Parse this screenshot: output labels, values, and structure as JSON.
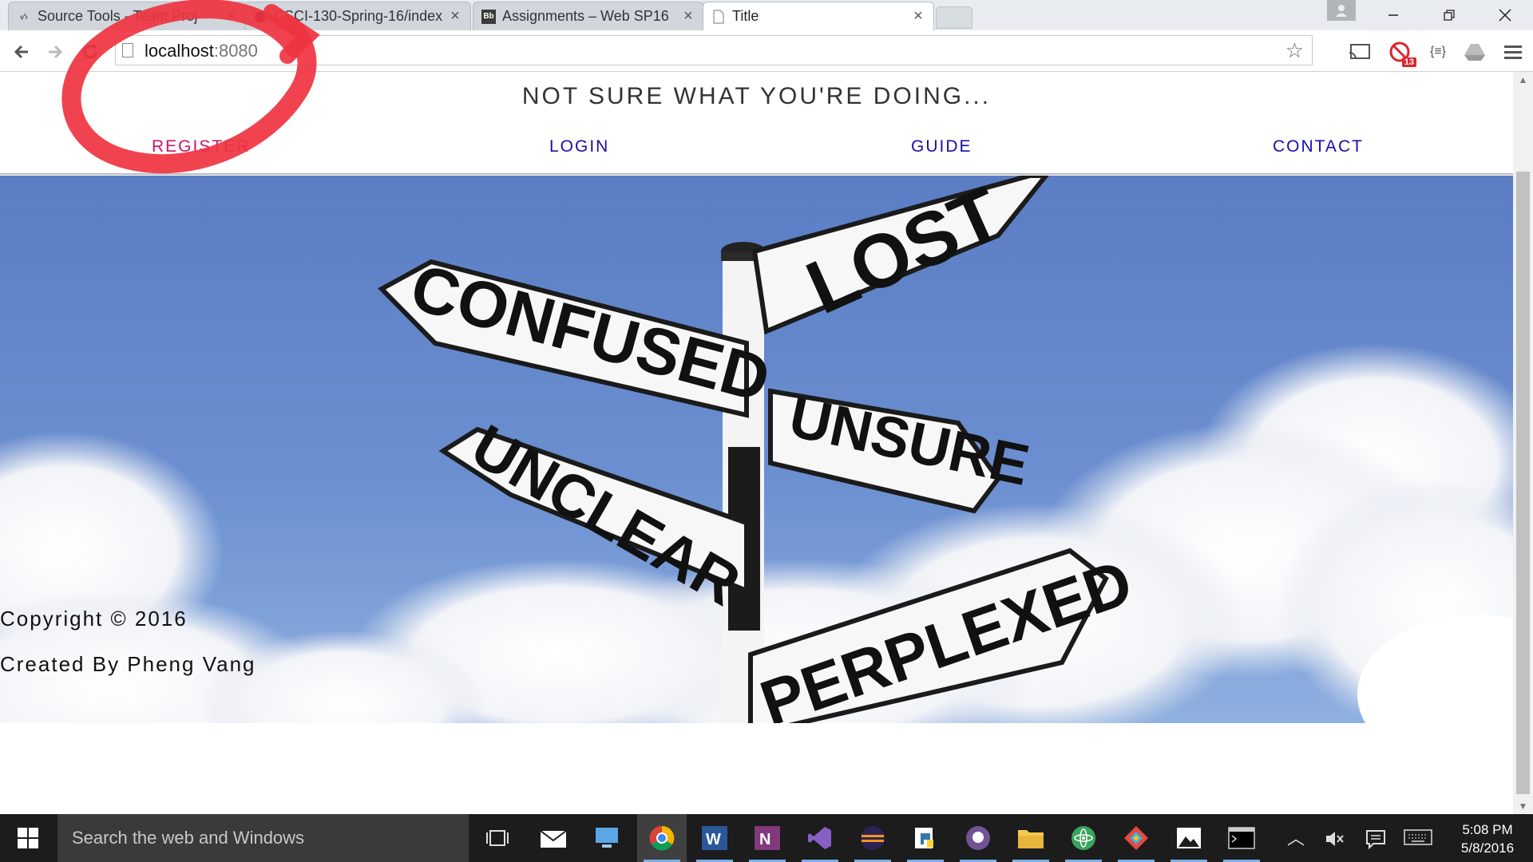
{
  "browser": {
    "tabs": [
      {
        "label": "Source Tools - Team Proj",
        "icon": "code-brackets-icon"
      },
      {
        "label": "CSCI-130-Spring-16/index",
        "icon": "github-icon"
      },
      {
        "label": "Assignments – Web SP16",
        "icon": "blackboard-icon"
      },
      {
        "label": "Title",
        "icon": "page-icon"
      }
    ],
    "url_host": "localhost",
    "url_port": ":8080",
    "extension_badge": "13"
  },
  "site": {
    "title": "NOT SURE WHAT YOU'RE DOING...",
    "nav": {
      "register": "REGISTER",
      "login": "LOGIN",
      "guide": "GUIDE",
      "contact": "CONTACT"
    },
    "hero_signs": {
      "lost": "LOST",
      "confused": "CONFUSED",
      "unsure": "UNSURE",
      "unclear": "UNCLEAR",
      "perplexed": "PERPLEXED"
    },
    "footer": {
      "copyright": "Copyright © 2016",
      "credit": "Created By Pheng Vang"
    }
  },
  "taskbar": {
    "search_placeholder": "Search the web and Windows",
    "apps": [
      "task-view",
      "mail",
      "remote-desktop",
      "chrome",
      "word",
      "onenote",
      "visual-studio",
      "eclipse",
      "python",
      "github-desktop",
      "file-explorer",
      "atom",
      "git-kraken",
      "photos",
      "terminal"
    ],
    "clock": {
      "time": "5:08 PM",
      "date": "5/8/2016"
    }
  },
  "colors": {
    "link": "#1a0dab",
    "visited_link": "#c8156e",
    "annotation": "#ef3340",
    "sky_top": "#5a7dc4",
    "taskbar": "#1c1c1c"
  }
}
